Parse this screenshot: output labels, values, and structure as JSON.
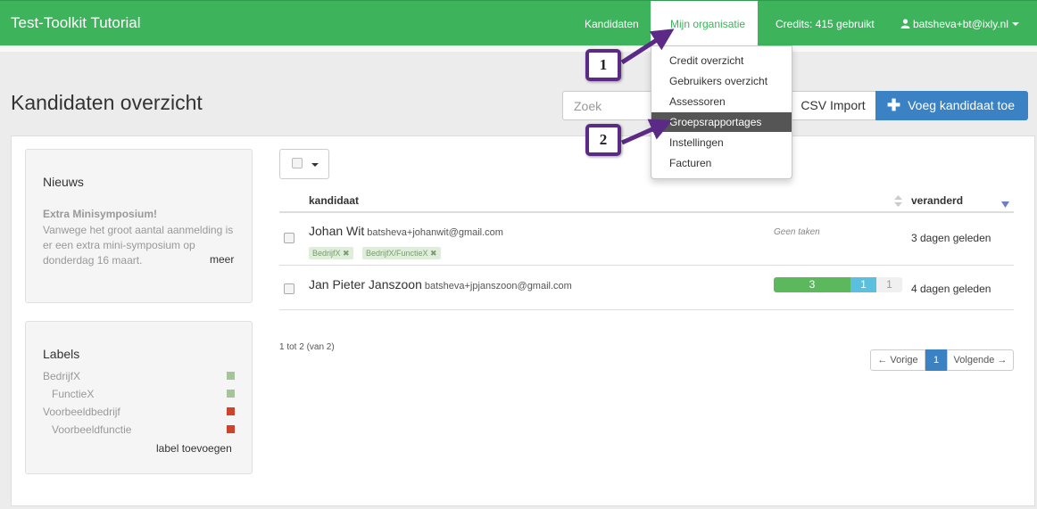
{
  "navbar": {
    "brand": "Test-Toolkit Tutorial",
    "candidates": "Kandidaten",
    "my_org": "Mijn organisatie",
    "credits": "Credits: 415 gebruikt",
    "user": "batsheva+bt@ixly.nl"
  },
  "page": {
    "title": "Kandidaten overzicht",
    "search_placeholder": "Zoek",
    "csv_import": "CSV Import",
    "add_candidate": "Voeg kandidaat toe"
  },
  "news": {
    "title": "Nieuws",
    "headline": "Extra Minisymposium!",
    "body": "Vanwege het groot aantal aanmelding is er een extra mini-symposium op donderdag 16 maart.",
    "more": "meer"
  },
  "labels": {
    "title": "Labels",
    "items": [
      {
        "name": "BedrijfX",
        "color": "#a6c49a"
      },
      {
        "name": "FunctieX",
        "color": "#a6c49a"
      },
      {
        "name": "Voorbeeldbedrijf",
        "color": "#d0432b"
      },
      {
        "name": "Voorbeeldfunctie",
        "color": "#d0432b"
      }
    ],
    "add": "label toevoegen"
  },
  "table": {
    "col_candidate": "kandidaat",
    "col_changed": "veranderd",
    "rows": [
      {
        "name": "Johan Wit",
        "email": "batsheva+johanwit@gmail.com",
        "tags": [
          "BedrijfX ✖",
          "BedrijfX/FunctieX ✖"
        ],
        "tasks": "Geen taken",
        "changed": "3 dagen geleden"
      },
      {
        "name": "Jan Pieter Janszoon",
        "email": "batsheva+jpjanszoon@gmail.com",
        "progress": {
          "done": "3",
          "busy": "1",
          "open": "1"
        },
        "changed": "4 dagen geleden"
      }
    ],
    "count_text": "1 tot 2 (van 2)",
    "prev": "← Vorige",
    "page": "1",
    "next": "Volgende →"
  },
  "dropdown": {
    "items": [
      "Credit overzicht",
      "Gebruikers overzicht",
      "Assessoren",
      "Groepsrapportages",
      "Instellingen",
      "Facturen"
    ],
    "highlighted": "Groepsrapportages"
  },
  "callouts": [
    "1",
    "2"
  ],
  "colors": {
    "brand_green": "#3db35c",
    "primary_blue": "#3a82c4",
    "callout_purple": "#5b2a87",
    "progress_done": "#5cb85c",
    "progress_busy": "#5bc0de"
  }
}
